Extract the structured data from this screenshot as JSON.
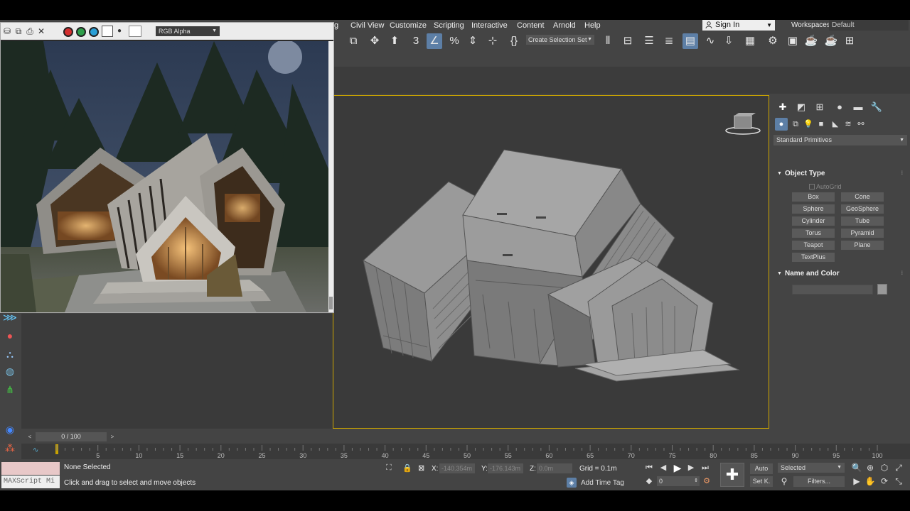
{
  "menubar": {
    "items": [
      {
        "label": "g"
      },
      {
        "label": "Civil View"
      },
      {
        "label": "Customize"
      },
      {
        "label": "Scripting"
      },
      {
        "label": "Interactive"
      },
      {
        "label": "Content"
      },
      {
        "label": "Arnold"
      },
      {
        "label": "Help"
      }
    ],
    "sign_in": "Sign In",
    "workspaces_label": "Workspaces:",
    "workspaces_value": "Default"
  },
  "toolbar": {
    "selection_set_placeholder": "Create Selection Set"
  },
  "render_frame": {
    "channel": "RGB Alpha",
    "color_dots": [
      "#d32f2f",
      "#2e9e4a",
      "#2a9fd6"
    ]
  },
  "command_panel": {
    "category": "Standard Primitives",
    "object_type_title": "Object Type",
    "autogrid_label": "AutoGrid",
    "primitives": [
      "Box",
      "Cone",
      "Sphere",
      "GeoSphere",
      "Cylinder",
      "Tube",
      "Torus",
      "Pyramid",
      "Teapot",
      "Plane",
      "TextPlus"
    ],
    "name_color_title": "Name and Color",
    "object_color": "#999999"
  },
  "timeline": {
    "frame_display": "0 / 100",
    "ticks": [
      "5",
      "10",
      "15",
      "20",
      "25",
      "30",
      "35",
      "40",
      "45",
      "50",
      "55",
      "60",
      "65",
      "70",
      "75",
      "80",
      "85",
      "90",
      "95",
      "100"
    ]
  },
  "statusbar": {
    "maxscript_placeholder": "MAXScript Mi",
    "selection_status": "None Selected",
    "prompt": "Click and drag to select and move objects",
    "x_label": "X:",
    "x_value": "-140.354m",
    "y_label": "Y:",
    "y_value": "-176.143m",
    "z_label": "Z:",
    "z_value": "0.0m",
    "grid": "Grid = 0.1m",
    "add_time_tag": "Add Time Tag",
    "current_frame": "0",
    "auto_label": "Auto",
    "setkey_label": "Set K.",
    "selected_value": "Selected",
    "filters_label": "Filters..."
  }
}
